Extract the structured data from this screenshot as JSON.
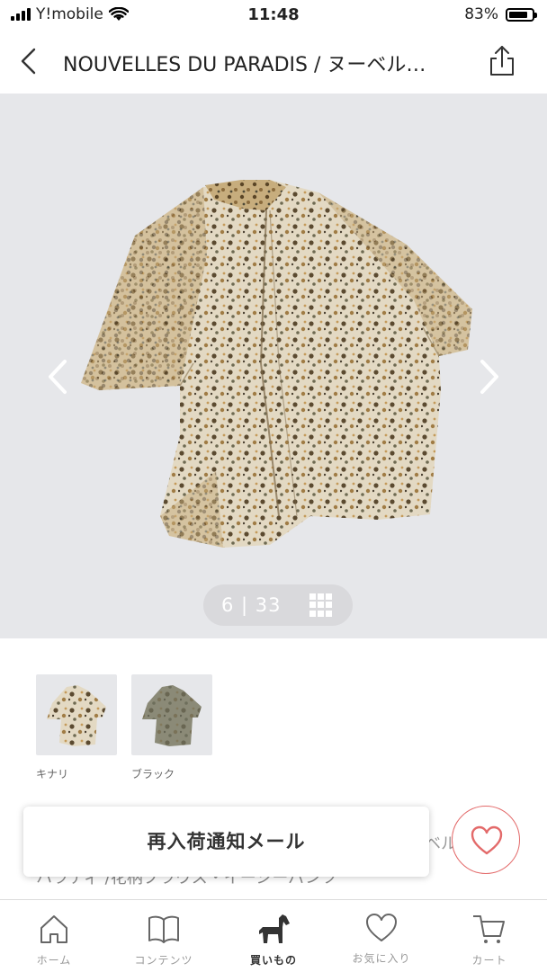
{
  "status_bar": {
    "carrier": "Y!mobile",
    "time": "11:48",
    "battery_percent": "83%",
    "battery_level": 0.83
  },
  "header": {
    "title": "NOUVELLES DU PARADIS / ヌーベル…",
    "back_icon": "chevron-left-icon",
    "share_icon": "share-icon"
  },
  "gallery": {
    "counter": "6 | 33",
    "current_index": 6,
    "total": 33,
    "prev_icon": "chevron-left-icon",
    "next_icon": "chevron-right-icon",
    "grid_icon": "grid-icon"
  },
  "variants": [
    {
      "label": "キナリ"
    },
    {
      "label": "ブラック"
    }
  ],
  "restock": {
    "button_label": "再入荷通知メール",
    "brand_tail": "ベル",
    "product_line": "ハラティ /花柄ブラウス・イージーパンツ"
  },
  "favorite": {
    "icon": "heart-icon",
    "accent_color": "#e36a6a"
  },
  "tab_bar": {
    "tabs": [
      {
        "label": "ホーム",
        "icon": "home-icon"
      },
      {
        "label": "コンテンツ",
        "icon": "book-icon"
      },
      {
        "label": "買いもの",
        "icon": "horse-icon",
        "active": true
      },
      {
        "label": "お気に入り",
        "icon": "heart-icon"
      },
      {
        "label": "カート",
        "icon": "cart-icon"
      }
    ]
  }
}
